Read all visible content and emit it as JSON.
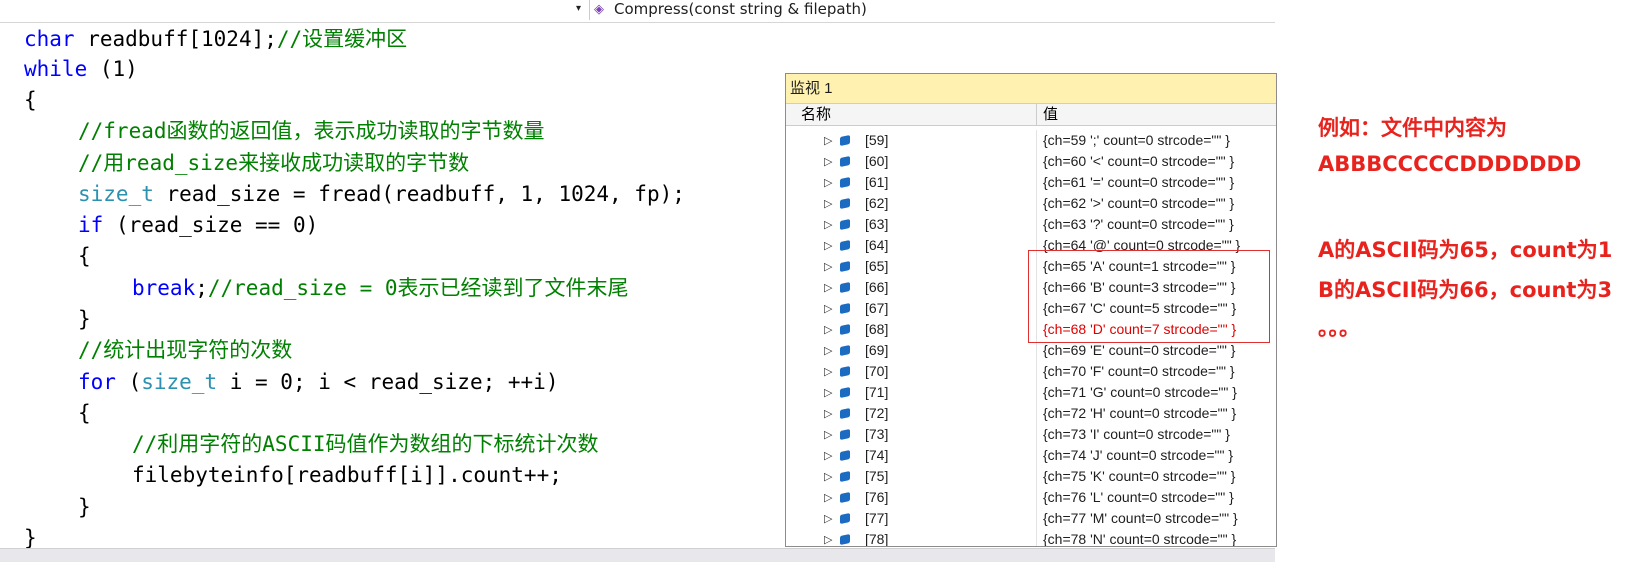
{
  "navbar": {
    "member_combo": "Compress(const string & filepath)",
    "member_icon": "method-icon"
  },
  "code": {
    "line1_type": "char",
    "line1_rest": " readbuff[1024];",
    "line1_comment": "//设置缓冲区",
    "line2_kw": "while",
    "line2_rest": " (1)",
    "brace_open": "{",
    "line4_comment": "//fread函数的返回值，表示成功读取的字节数量",
    "line5_comment": "//用read_size来接收成功读取的字节数",
    "line6_type": "size_t",
    "line6_rest": " read_size = fread(readbuff, 1, 1024, fp);",
    "line7_kw": "if",
    "line7_rest": " (read_size == 0)",
    "line8": "{",
    "line9_kw": "break",
    "line9_semi": ";",
    "line9_comment": "//read_size = 0表示已经读到了文件末尾",
    "line10": "}",
    "line11_comment": "//统计出现字符的次数",
    "line12_kw": "for",
    "line12_p": " (",
    "line12_type": "size_t",
    "line12_rest": " i = 0; i < read_size; ++i)",
    "line13": "{",
    "line14_comment": "//利用字符的ASCII码值作为数组的下标统计次数",
    "line15": "filebyteinfo[readbuff[i]].count++;",
    "line16": "}",
    "brace_close": "}"
  },
  "watch": {
    "title": "监视 1",
    "col_name": "名称",
    "col_value": "值",
    "rows": [
      {
        "name": "[59]",
        "value": "{ch=59 ';' count=0 strcode=\"\" }"
      },
      {
        "name": "[60]",
        "value": "{ch=60 '<' count=0 strcode=\"\" }"
      },
      {
        "name": "[61]",
        "value": "{ch=61 '=' count=0 strcode=\"\" }"
      },
      {
        "name": "[62]",
        "value": "{ch=62 '>' count=0 strcode=\"\" }"
      },
      {
        "name": "[63]",
        "value": "{ch=63 '?' count=0 strcode=\"\" }"
      },
      {
        "name": "[64]",
        "value": "{ch=64 '@' count=0 strcode=\"\" }"
      },
      {
        "name": "[65]",
        "value": "{ch=65 'A' count=1 strcode=\"\" }"
      },
      {
        "name": "[66]",
        "value": "{ch=66 'B' count=3 strcode=\"\" }"
      },
      {
        "name": "[67]",
        "value": "{ch=67 'C' count=5 strcode=\"\" }"
      },
      {
        "name": "[68]",
        "value": "{ch=68 'D' count=7 strcode=\"\" }"
      },
      {
        "name": "[69]",
        "value": "{ch=69 'E' count=0 strcode=\"\" }"
      },
      {
        "name": "[70]",
        "value": "{ch=70 'F' count=0 strcode=\"\" }"
      },
      {
        "name": "[71]",
        "value": "{ch=71 'G' count=0 strcode=\"\" }"
      },
      {
        "name": "[72]",
        "value": "{ch=72 'H' count=0 strcode=\"\" }"
      },
      {
        "name": "[73]",
        "value": "{ch=73 'I' count=0 strcode=\"\" }"
      },
      {
        "name": "[74]",
        "value": "{ch=74 'J' count=0 strcode=\"\" }"
      },
      {
        "name": "[75]",
        "value": "{ch=75 'K' count=0 strcode=\"\" }"
      },
      {
        "name": "[76]",
        "value": "{ch=76 'L' count=0 strcode=\"\" }"
      },
      {
        "name": "[77]",
        "value": "{ch=77 'M' count=0 strcode=\"\" }"
      },
      {
        "name": "[78]",
        "value": "{ch=78 'N' count=0 strcode=\"\" }"
      }
    ],
    "highlight_color": "#e00000"
  },
  "note": {
    "line1": "例如：文件中内容为",
    "line2": "ABBBCCCCCDDDDDDD",
    "line3": "A的ASCII码为65，count为1",
    "line4": "B的ASCII码为66，count为3",
    "line5": "。。。",
    "color": "#e8231e"
  }
}
